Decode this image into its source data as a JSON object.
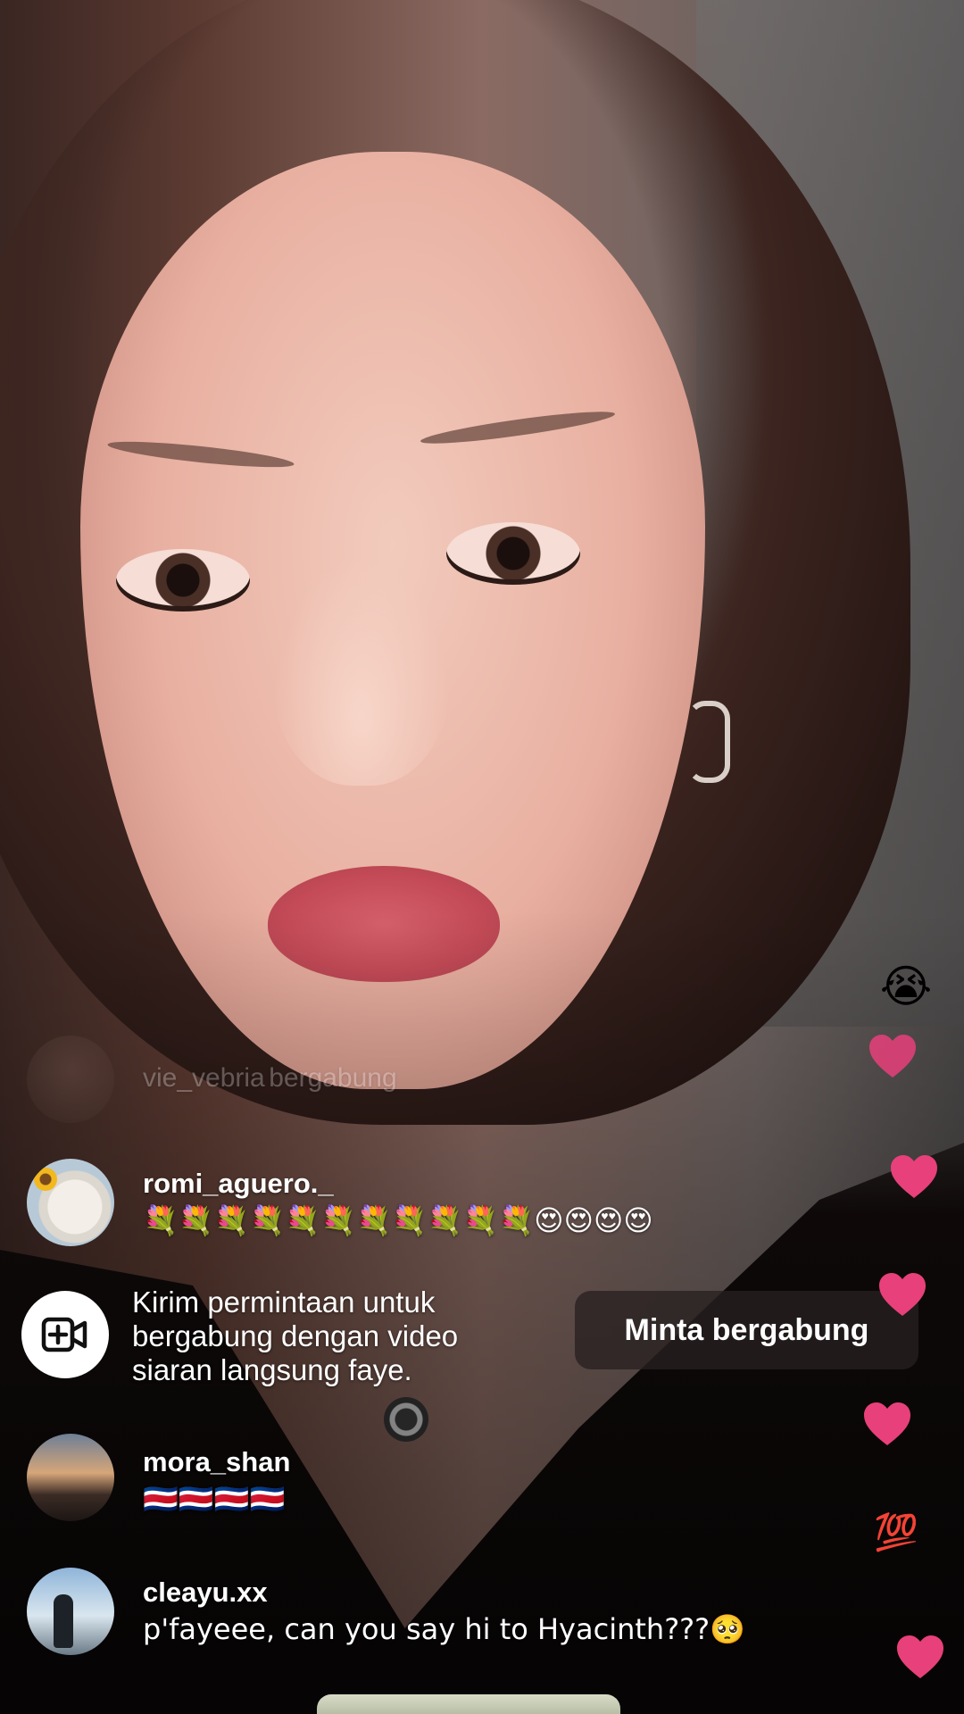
{
  "live": {
    "host": "faye"
  },
  "comments": {
    "faded": {
      "username": "vie_vebria",
      "text": "bergabung"
    },
    "items": [
      {
        "username": "romi_aguero._",
        "text": "💐💐💐💐💐💐💐💐💐💐💐😍😍😍😍"
      },
      {
        "username": "mora_shan",
        "text": "🇨🇷🇨🇷🇨🇷🇨🇷"
      },
      {
        "username": "cleayu.xx",
        "text": "p'fayeee, can you say hi to Hyacinth???🥺"
      }
    ]
  },
  "join_request": {
    "message": "Kirim permintaan untuk bergabung dengan video siaran langsung faye.",
    "button_label": "Minta bergabung",
    "icon": "video-add-icon"
  },
  "reactions": [
    {
      "type": "emoji",
      "value": "😭"
    },
    {
      "type": "heart",
      "color": "#e8407a"
    },
    {
      "type": "heart",
      "color": "#e8407a"
    },
    {
      "type": "heart",
      "color": "#e8407a"
    },
    {
      "type": "heart",
      "color": "#e8407a"
    },
    {
      "type": "emoji",
      "value": "💯"
    },
    {
      "type": "heart",
      "color": "#e8407a"
    }
  ],
  "colors": {
    "heart": "#e8407a",
    "button_bg": "#2b2222",
    "text": "#ffffff"
  }
}
